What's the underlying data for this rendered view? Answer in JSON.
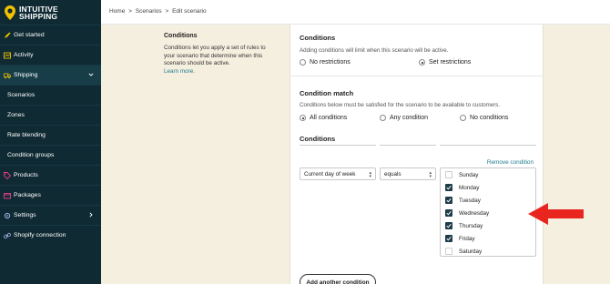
{
  "brand": {
    "line1": "INTUITIVE",
    "line2": "SHIPPING"
  },
  "breadcrumb": {
    "home": "Home",
    "sep1": ">",
    "scenarios": "Scenarios",
    "sep2": ">",
    "current": "Edit scenario"
  },
  "sidebar": {
    "items": [
      {
        "label": "Get started",
        "icon": "rocket-icon"
      },
      {
        "label": "Activity",
        "icon": "activity-icon"
      },
      {
        "label": "Shipping",
        "icon": "truck-icon"
      },
      {
        "label": "Scenarios"
      },
      {
        "label": "Zones"
      },
      {
        "label": "Rate blending"
      },
      {
        "label": "Condition groups"
      },
      {
        "label": "Products",
        "icon": "tag-icon"
      },
      {
        "label": "Packages",
        "icon": "package-icon"
      },
      {
        "label": "Settings",
        "icon": "gear-icon"
      },
      {
        "label": "Shopify connection",
        "icon": "link-icon"
      }
    ]
  },
  "info": {
    "title": "Conditions",
    "description": "Conditions let you apply a set of rules to your scenario that determine when this scenario should be active.",
    "link": "Learn more."
  },
  "conditions": {
    "title": "Conditions",
    "description": "Adding conditions will limit when this scenario will be active.",
    "options": [
      "No restrictions",
      "Set restrictions"
    ],
    "selected": "Set restrictions"
  },
  "match": {
    "title": "Condition match",
    "description": "Conditions below must be satisfied for the scenario to be available to customers.",
    "options": [
      "All conditions",
      "Any condition",
      "No conditions"
    ],
    "selected": "All conditions"
  },
  "rules": {
    "title": "Conditions",
    "remove_label": "Remove condition",
    "field": "Current day of week",
    "operator": "equals",
    "days": [
      {
        "label": "Sunday",
        "checked": false
      },
      {
        "label": "Monday",
        "checked": true
      },
      {
        "label": "Tuesday",
        "checked": true
      },
      {
        "label": "Wednesday",
        "checked": true
      },
      {
        "label": "Thursday",
        "checked": true
      },
      {
        "label": "Friday",
        "checked": true
      },
      {
        "label": "Saturday",
        "checked": false
      }
    ],
    "add_label": "Add another condition"
  },
  "colors": {
    "sidebar": "#0f2a33",
    "accent": "#1f7a8c",
    "background": "#f5efe0",
    "arrow": "#e8251f",
    "logo_pin": "#f2c200"
  }
}
